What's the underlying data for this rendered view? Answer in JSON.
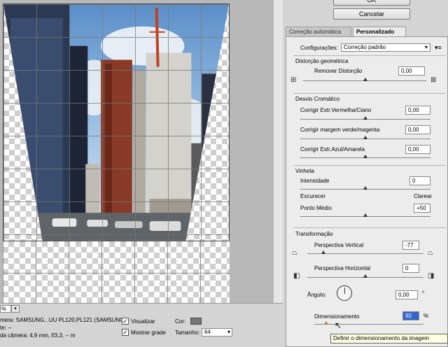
{
  "canvas": {
    "zoom": "%",
    "camera_line": "mera: SAMSUNG...UU PL120,PL121 (SAMSUNG)",
    "lens_line": "te: --",
    "camera_settings_line": "da câmera: 4,9 mm, f/3,3, -- m",
    "visualizar_label": "Visualizar",
    "mostrar_grade_label": "Mostrar grade",
    "cor_label": "Cor:",
    "tamanho_label": "Tamanho:",
    "tamanho_value": "64"
  },
  "buttons": {
    "ok": "OK",
    "cancel": "Cancelar"
  },
  "tabs": {
    "auto": "Correção automática",
    "custom": "Personalizado"
  },
  "settings": {
    "label": "Configurações:",
    "value": "Correção padrão",
    "menu_icon": "▾≡"
  },
  "geometry": {
    "title": "Distorção geométrica",
    "remove_label": "Remover Distorção",
    "remove_value": "0,00"
  },
  "chromatic": {
    "title": "Desvio Cromático",
    "red_cyan_label": "Corrigir Extr.Vermelha/Ciano",
    "red_cyan_value": "0,00",
    "green_magenta_label": "Corrigir margem verde/magenta",
    "green_magenta_value": "0,00",
    "blue_yellow_label": "Corrigir Extr.Azul/Amarela",
    "blue_yellow_value": "0,00"
  },
  "vignette": {
    "title": "Vinheta",
    "intensity_label": "Intensidade",
    "intensity_value": "0",
    "darken_label": "Escurecer",
    "lighten_label": "Clarear",
    "midpoint_label": "Ponto Médio",
    "midpoint_value": "+50"
  },
  "transform": {
    "title": "Transformação",
    "vertical_label": "Perspectiva Vertical",
    "vertical_value": "-77",
    "horizontal_label": "Perspectiva Horizontal",
    "horizontal_value": "0",
    "angle_label": "Ângulo:",
    "angle_value": "0,00",
    "angle_unit": "°",
    "scale_label": "Dimensionamento",
    "scale_value": "60",
    "scale_unit": "%"
  },
  "tooltip": "Definir o dimensionamento da imagem"
}
